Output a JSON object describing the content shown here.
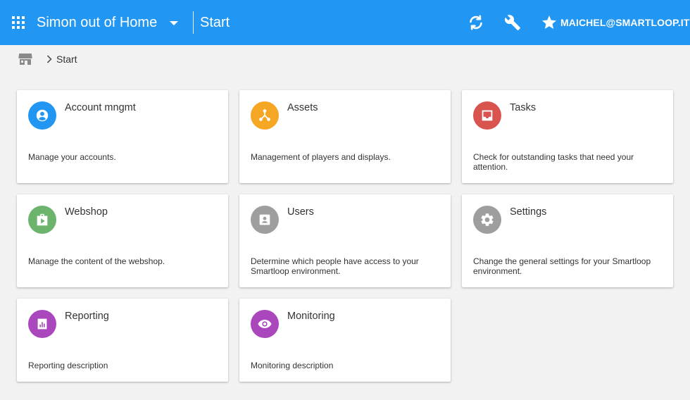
{
  "header": {
    "org_name": "Simon out of Home",
    "page_title": "Start",
    "user_email": "MAICHEL@SMARTLOOP.IT",
    "icons": [
      "apps-icon",
      "arrow-drop-down-icon",
      "sync-icon",
      "wrench-icon",
      "star-icon"
    ],
    "colors": {
      "bar": "#2196f3",
      "text": "#ffffff"
    }
  },
  "breadcrumb": {
    "home_icon": "store-icon",
    "separator_icon": "chevron-right-icon",
    "current": "Start"
  },
  "cards": [
    {
      "title": "Account mngmt",
      "description": "Manage your accounts.",
      "icon": "account-circle-icon",
      "color": "#2196f3"
    },
    {
      "title": "Assets",
      "description": "Management of players and displays.",
      "icon": "hub-icon",
      "color": "#f5a623"
    },
    {
      "title": "Tasks",
      "description": "Check for outstanding tasks that need your attention.",
      "icon": "inbox-icon",
      "color": "#d9534f"
    },
    {
      "title": "Webshop",
      "description": "Manage the content of the webshop.",
      "icon": "shop-icon",
      "color": "#6cb36c"
    },
    {
      "title": "Users",
      "description": "Determine which people have access to your Smartloop environment.",
      "icon": "contact-card-icon",
      "color": "#9e9e9e"
    },
    {
      "title": "Settings",
      "description": "Change the general settings for your Smartloop environment.",
      "icon": "gear-icon",
      "color": "#9e9e9e"
    },
    {
      "title": "Reporting",
      "description": "Reporting description",
      "icon": "bar-chart-icon",
      "color": "#ab47bc"
    },
    {
      "title": "Monitoring",
      "description": "Monitoring description",
      "icon": "eye-icon",
      "color": "#ab47bc"
    }
  ]
}
